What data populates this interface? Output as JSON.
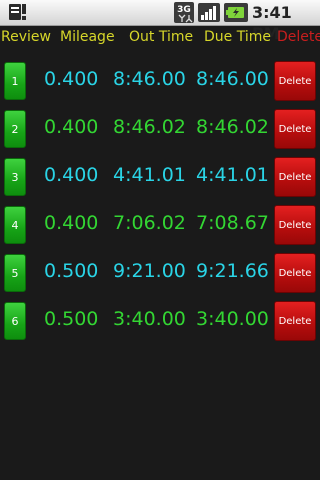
{
  "status_bar": {
    "time": "3:41 PM",
    "network_label": "3G",
    "icons": [
      "notification-icon",
      "3g-data-icon",
      "signal-icon",
      "battery-charging-icon"
    ]
  },
  "header": {
    "review": "Review",
    "mileage": "Mileage",
    "out_time": "Out Time",
    "due_time": "Due Time",
    "delete": "Delete"
  },
  "colors": {
    "header": "#d6d62a",
    "delete_header": "#c81e1e",
    "cyan": "#2ad4e6",
    "green": "#33d633",
    "review_button": "#17a417",
    "delete_button": "#b50d0d"
  },
  "rows": [
    {
      "review": "1",
      "mileage": "0.400",
      "out_time": "8:46.00",
      "due_time": "8:46.00",
      "delete": "Delete",
      "color": "cyan"
    },
    {
      "review": "2",
      "mileage": "0.400",
      "out_time": "8:46.02",
      "due_time": "8:46.02",
      "delete": "Delete",
      "color": "green"
    },
    {
      "review": "3",
      "mileage": "0.400",
      "out_time": "4:41.01",
      "due_time": "4:41.01",
      "delete": "Delete",
      "color": "cyan"
    },
    {
      "review": "4",
      "mileage": "0.400",
      "out_time": "7:06.02",
      "due_time": "7:08.67",
      "delete": "Delete",
      "color": "green"
    },
    {
      "review": "5",
      "mileage": "0.500",
      "out_time": "9:21.00",
      "due_time": "9:21.66",
      "delete": "Delete",
      "color": "cyan"
    },
    {
      "review": "6",
      "mileage": "0.500",
      "out_time": "3:40.00",
      "due_time": "3:40.00",
      "delete": "Delete",
      "color": "green"
    }
  ]
}
